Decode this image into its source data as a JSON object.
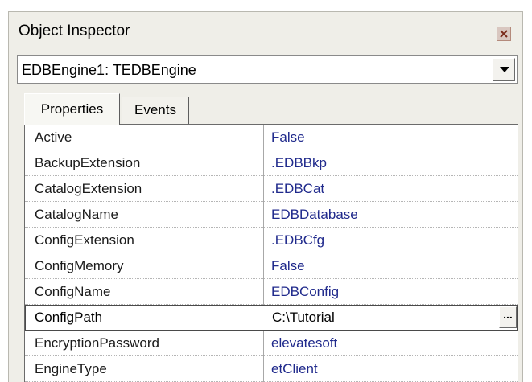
{
  "window": {
    "title": "Object Inspector"
  },
  "selector": {
    "value": "EDBEngine1: TEDBEngine"
  },
  "tabs": [
    {
      "label": "Properties",
      "active": true
    },
    {
      "label": "Events",
      "active": false
    }
  ],
  "properties": [
    {
      "name": "Active",
      "value": "False"
    },
    {
      "name": "BackupExtension",
      "value": ".EDBBkp"
    },
    {
      "name": "CatalogExtension",
      "value": ".EDBCat"
    },
    {
      "name": "CatalogName",
      "value": "EDBDatabase"
    },
    {
      "name": "ConfigExtension",
      "value": ".EDBCfg"
    },
    {
      "name": "ConfigMemory",
      "value": "False"
    },
    {
      "name": "ConfigName",
      "value": "EDBConfig"
    },
    {
      "name": "ConfigPath",
      "value": "C:\\Tutorial",
      "selected": true,
      "ellipsis": "..."
    },
    {
      "name": "EncryptionPassword",
      "value": "elevatesoft"
    },
    {
      "name": "EngineType",
      "value": "etClient"
    }
  ],
  "colors": {
    "value_text": "#202a8c",
    "panel_bg": "#efeee8"
  },
  "icons": {
    "close": "close-icon",
    "dropdown": "chevron-down-icon"
  }
}
